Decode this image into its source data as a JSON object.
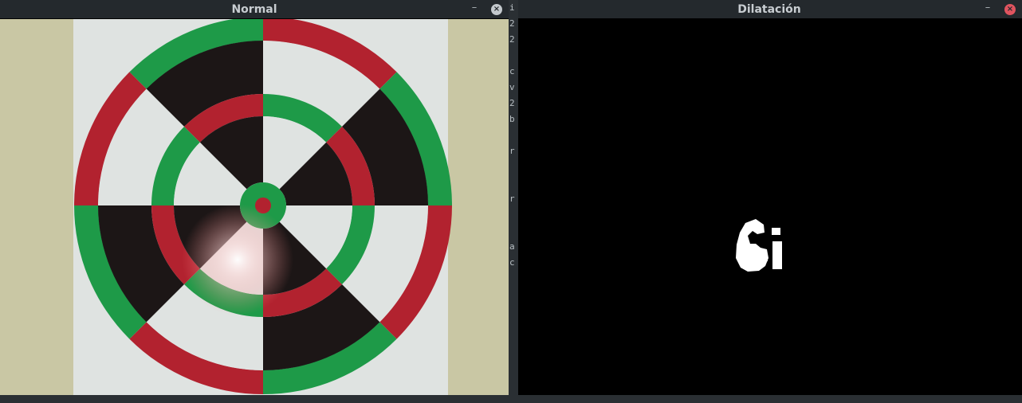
{
  "windows": {
    "left": {
      "title": "Normal",
      "minimize_glyph": "–",
      "close_glyph": "×",
      "close_color": "#c4c9cd"
    },
    "right": {
      "title": "Dilatación",
      "minimize_glyph": "–",
      "close_glyph": "×",
      "close_color": "#e0545f"
    }
  },
  "target": {
    "colors": {
      "red": "#b2222f",
      "green": "#1e9a48",
      "black": "#1c1616",
      "paper": "#dfe3e1",
      "wall": "#c9c7a4"
    }
  },
  "icons": {
    "minimize": "minimize-icon",
    "close": "close-icon"
  }
}
